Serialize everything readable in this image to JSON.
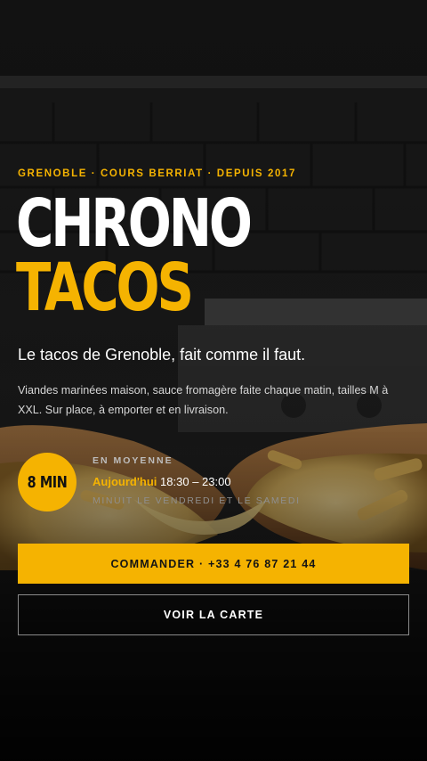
{
  "hero": {
    "eyebrow": "GRENOBLE · COURS BERRIAT · DEPUIS 2017",
    "title_line1": "CHRONO",
    "title_line2": "TACOS",
    "tagline": "Le tacos de Grenoble, fait comme il faut.",
    "description": "Viandes marinées maison, sauce fromagère faite chaque matin, tailles M à XXL. Sur place, à emporter et en livraison."
  },
  "hours": {
    "badge": "8 MIN",
    "label": "EN MOYENNE",
    "today_label": "Aujourd'hui",
    "today_time": "18:30 – 23:00",
    "note": "MINUIT LE VENDREDI ET LE SAMEDI"
  },
  "actions": {
    "order_label": "COMMANDER · +33 4 76 87 21 44",
    "menu_label": "VOIR LA CARTE"
  },
  "colors": {
    "accent": "#f5b301",
    "background": "#0c0c0c"
  }
}
